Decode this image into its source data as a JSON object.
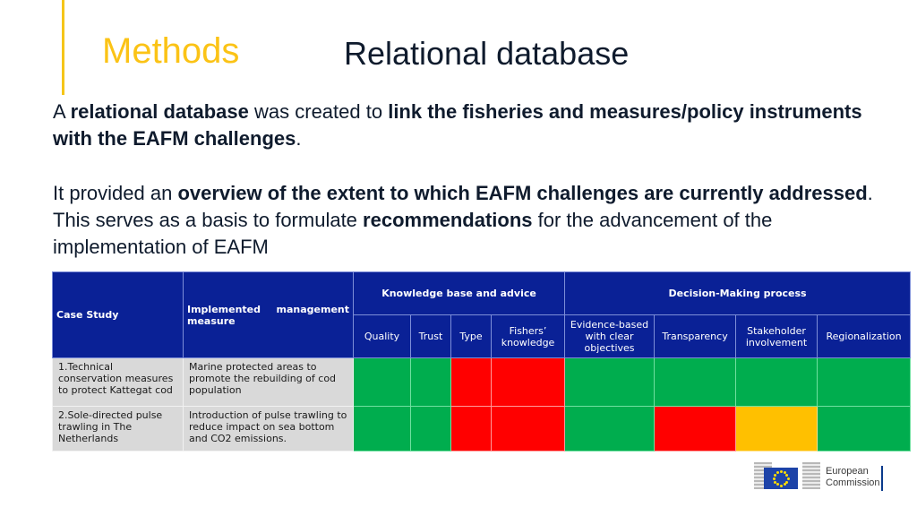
{
  "header": {
    "section": "Methods",
    "title": "Relational database"
  },
  "paragraph1": {
    "s1": "A ",
    "b1": "relational database",
    "s2": " was created to ",
    "b2": "link the fisheries and measures/policy instruments with the EAFM challenges",
    "s3": "."
  },
  "paragraph2": {
    "s1": "It provided an ",
    "b1": "overview of the extent to which EAFM challenges are currently addressed",
    "s2": ". This serves as a basis to formulate ",
    "b2": "recommendations",
    "s3": " for the advancement of the implementation of EAFM"
  },
  "table": {
    "col_case_study": "Case Study",
    "col_measure": "Implemented management measure",
    "group_knowledge": "Knowledge base and advice",
    "group_decision": "Decision-Making process",
    "subcolumns": [
      "Quality",
      "Trust",
      "Type",
      "Fishers’ knowledge",
      "Evidence-based with clear objectives",
      "Transparency",
      "Stakeholder involvement",
      "Regionalization"
    ],
    "rows": [
      {
        "case_study": "1.Technical conservation measures to protect Kattegat cod",
        "measure": "Marine protected areas to promote the rebuilding of cod population",
        "status": [
          "green",
          "green",
          "red",
          "red",
          "green",
          "green",
          "green",
          "green"
        ]
      },
      {
        "case_study": "2.Sole-directed pulse trawling in The Netherlands",
        "measure": "Introduction of pulse trawling to reduce impact on sea bottom and CO2 emissions.",
        "status": [
          "green",
          "green",
          "red",
          "red",
          "green",
          "red",
          "amber",
          "green"
        ]
      }
    ],
    "status_colors": {
      "green": "#00ad4e",
      "red": "#ff0000",
      "amber": "#ffc000"
    }
  },
  "colors": {
    "accent": "#fbc316",
    "header_blue": "#0a2196"
  },
  "footer": {
    "logo_text": "European Commission"
  }
}
